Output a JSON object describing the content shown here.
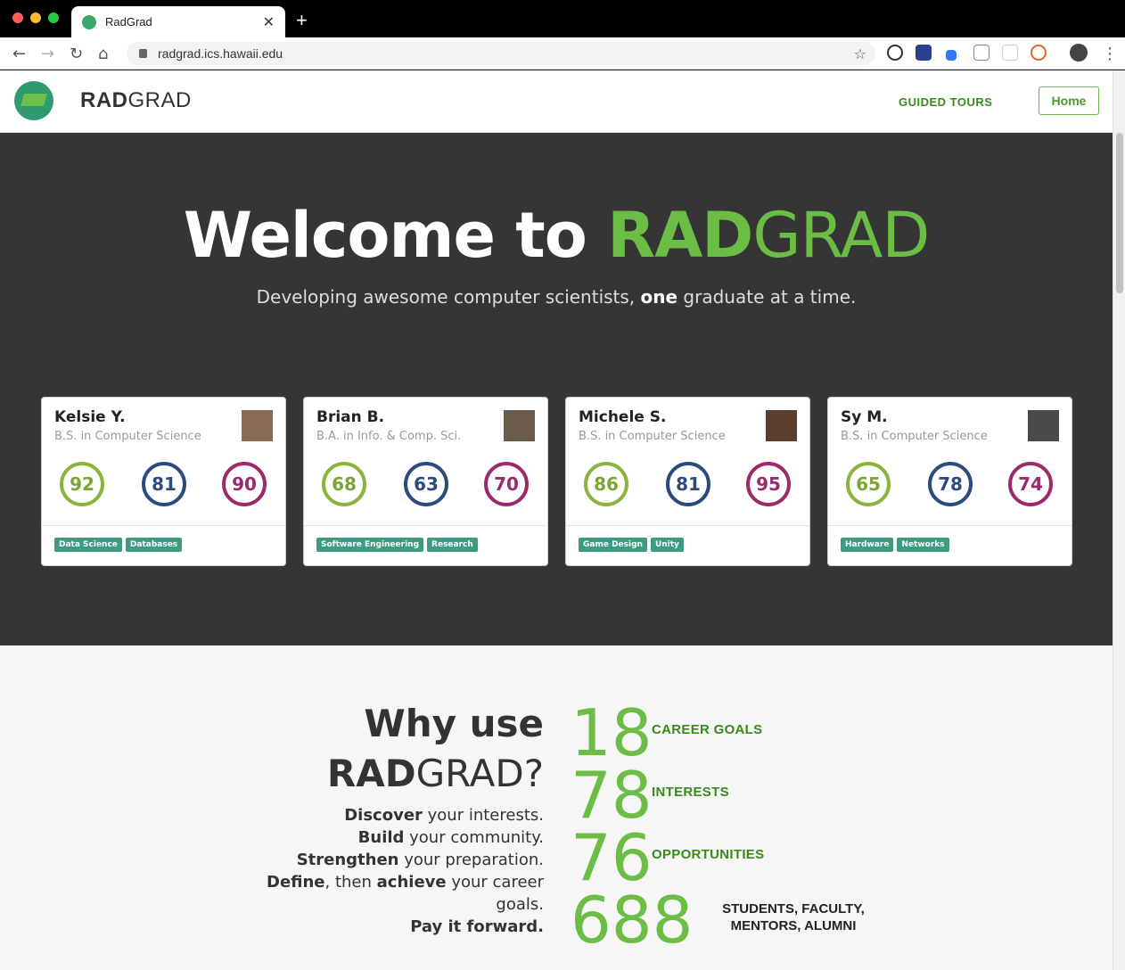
{
  "browser": {
    "tab_title": "RadGrad",
    "tab_close": "✕",
    "new_tab": "+",
    "url": "radgrad.ics.hawaii.edu"
  },
  "header": {
    "brand_bold": "RAD",
    "brand_rest": "GRAD",
    "guided_tours": "GUIDED TOURS",
    "home_button": "Home"
  },
  "hero": {
    "welcome_prefix": "Welcome to ",
    "welcome_rad": "RAD",
    "welcome_grad": "GRAD",
    "tagline_before": "Developing awesome computer scientists, ",
    "tagline_bold": "one",
    "tagline_after": " graduate at a time."
  },
  "cards": [
    {
      "name": "Kelsie Y.",
      "degree": "B.S. in Computer Science",
      "scores": [
        "92",
        "81",
        "90"
      ],
      "tags": [
        "Data Science",
        "Databases"
      ]
    },
    {
      "name": "Brian B.",
      "degree": "B.A. in Info. & Comp. Sci.",
      "scores": [
        "68",
        "63",
        "70"
      ],
      "tags": [
        "Software Engineering",
        "Research"
      ]
    },
    {
      "name": "Michele S.",
      "degree": "B.S. in Computer Science",
      "scores": [
        "86",
        "81",
        "95"
      ],
      "tags": [
        "Game Design",
        "Unity"
      ]
    },
    {
      "name": "Sy M.",
      "degree": "B.S. in Computer Science",
      "scores": [
        "65",
        "78",
        "74"
      ],
      "tags": [
        "Hardware",
        "Networks"
      ]
    }
  ],
  "why": {
    "line1": "Why use",
    "line2_bold": "RAD",
    "line2_rest": "GRAD?",
    "points": [
      {
        "bold": "Discover",
        "rest": " your interests."
      },
      {
        "bold": "Build",
        "rest": " your community."
      },
      {
        "bold": "Strengthen",
        "rest": " your preparation."
      },
      {
        "bold": "Pay it forward.",
        "rest": ""
      }
    ],
    "define_bold": "Define",
    "define_mid": ", then ",
    "define_bold2": "achieve",
    "define_rest": " your career goals."
  },
  "stats": [
    {
      "number": "18",
      "label": "CAREER GOALS"
    },
    {
      "number": "78",
      "label": "INTERESTS"
    },
    {
      "number": "76",
      "label": "OPPORTUNITIES"
    },
    {
      "number": "688",
      "label_line1": "STUDENTS, FACULTY,",
      "label_line2": "MENTORS, ALUMNI"
    }
  ],
  "colors": {
    "brand_green": "#6cbd45",
    "hero_bg": "#353535",
    "tag_green": "#3f9b80"
  }
}
